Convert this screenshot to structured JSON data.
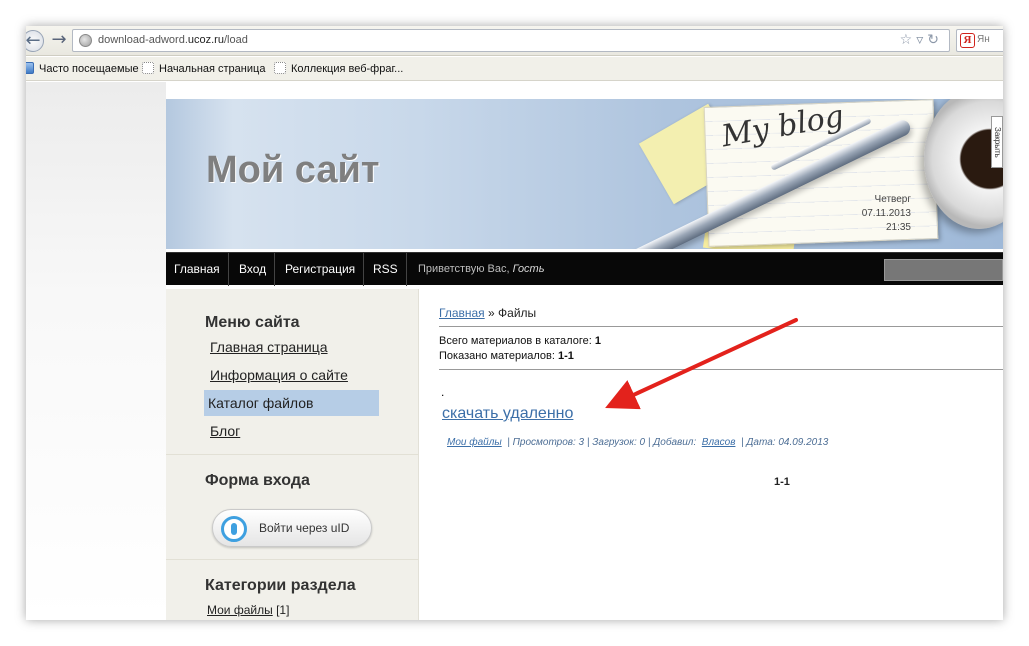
{
  "browser": {
    "url_prefix": "download-adword.",
    "url_domain": "ucoz.ru",
    "url_path": "/load",
    "search_text": "Ян",
    "bookmarks": [
      "Часто посещаемые",
      "Начальная страница",
      "Коллекция веб-фраг..."
    ]
  },
  "header": {
    "site_title": "Мой сайт",
    "blog_script": "My blog",
    "day": "Четверг",
    "date": "07.11.2013",
    "time": "21:35",
    "ad_tab": "Закрыть"
  },
  "nav": {
    "items": [
      "Главная",
      "Вход",
      "Регистрация",
      "RSS"
    ],
    "greeting": "Приветствую Вас,",
    "guest": "Гость"
  },
  "sidebar": {
    "menu_title": "Меню сайта",
    "menu_items": [
      "Главная страница",
      "Информация о сайте",
      "Каталог файлов",
      "Блог"
    ],
    "login_title": "Форма входа",
    "uid_label": "Войти через uID",
    "categories_title": "Категории раздела",
    "category_name": "Мои файлы",
    "category_count": "[1]"
  },
  "content": {
    "breadcrumb_home": "Главная",
    "breadcrumb_sep": " » ",
    "breadcrumb_current": "Файлы",
    "stats_total_label": "Всего материалов в каталоге: ",
    "stats_total_value": "1",
    "stats_shown_label": "Показано материалов: ",
    "stats_shown_value": "1-1",
    "dot": ".",
    "entry_title": "скачать удаленно",
    "entry_category": "Мои файлы",
    "entry_views": "| Просмотров: 3 | Загрузок: 0 | Добавил:",
    "entry_author": "Власов",
    "entry_date": "| Дата: 04.09.2013",
    "pager": "1-1"
  },
  "colors": {
    "link": "#3c6fa8",
    "arrow": "#e3221c",
    "active_menu": "#b6cde6",
    "navbar": "#080808"
  }
}
